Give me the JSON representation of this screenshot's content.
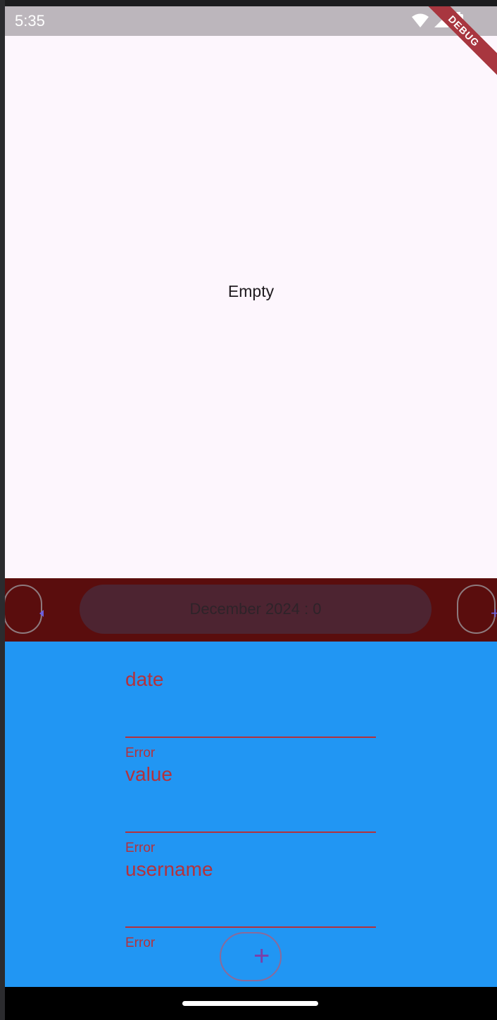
{
  "status_bar": {
    "time": "5:35"
  },
  "debug_banner": "DEBUG",
  "main": {
    "empty_text": "Empty"
  },
  "month_bar": {
    "label": "December 2024 : 0",
    "prev_icon": "chevron-left-icon",
    "next_icon": "chevron-right-icon"
  },
  "form": {
    "fields": [
      {
        "label": "date",
        "error": "Error"
      },
      {
        "label": "value",
        "error": "Error"
      },
      {
        "label": "username",
        "error": "Error"
      }
    ],
    "add_icon": "+"
  },
  "colors": {
    "background": "#fdf6fd",
    "month_bar": "#5a0d0d",
    "form_background": "#2196f3",
    "error": "#b3323c",
    "accent": "#6d5fe0"
  }
}
